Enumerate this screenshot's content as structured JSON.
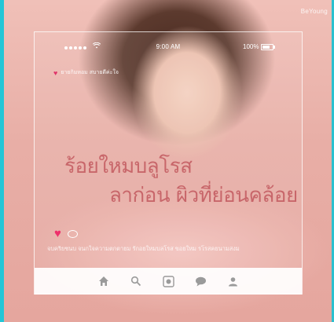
{
  "brand": {
    "label": "BeYoung"
  },
  "status_bar": {
    "time": "9:00 AM",
    "battery": "100%"
  },
  "post": {
    "account": "ยายกิมหอม สบายดีค่ะใจ",
    "headline_line1": "ร้อยใหมบลูโรส",
    "headline_line2": "ลาก่อน ผิวที่ย่อนคล้อย",
    "caption": "จบคริยชนบ จนกใจความตกตายม รักอยใหมบลโรส ขอยใหม รโรสคยนามสงม"
  },
  "icons": {
    "like": "heart-icon",
    "comment": "comment-icon",
    "home": "home-icon",
    "search": "search-icon",
    "camera": "camera-icon",
    "activity": "chat-bubble-icon",
    "profile": "profile-icon"
  },
  "colors": {
    "accent": "#23c6d6",
    "heart": "#ee2f6b",
    "headline": "#c46064",
    "background": "#e9b4ad"
  }
}
